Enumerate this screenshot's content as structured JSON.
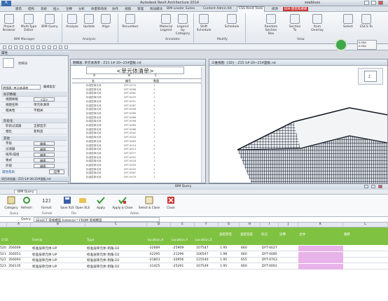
{
  "app": {
    "title": "Autodesk Revit Architecture 2014",
    "user": "seablues",
    "menu_label": "R"
  },
  "ribbon_tabs": [
    "建筑",
    "结构",
    "系统",
    "插入",
    "注释",
    "分析",
    "体量和场地",
    "协作",
    "视图",
    "管理",
    "附加模块",
    "BIM Leader Suites",
    "Content Admin Kit",
    "CSS Revit Tools",
    "修改",
    "BIM-建筑和楼梯"
  ],
  "ribbon": {
    "buttons": [
      "Project Browser",
      "Multi-Type Editor",
      "BIM Query",
      "Analyze",
      "Update",
      "Align",
      "Renumber",
      "Material Legend",
      "Legend by Category",
      "Shift Schedule",
      "Schedule",
      "Random Section Box",
      "Section To",
      "Item Overlay",
      "Select",
      "ESCS To"
    ],
    "panels": [
      "BIM Manager",
      "Analysis",
      "Annotate",
      "Modify",
      "View"
    ]
  },
  "left_pane": {
    "properties_title": "属性",
    "type_selector": "明细表: 单元体清单",
    "edit_type": "编辑类型",
    "sections": [
      {
        "name": "标识数据",
        "rows": [
          {
            "k": "视图样板",
            "v": "<无>",
            "btn": true
          },
          {
            "k": "视图名称",
            "v": "单元体清单"
          },
          {
            "k": "相关性",
            "v": "不相关"
          }
        ]
      },
      {
        "name": "阶段化",
        "rows": [
          {
            "k": "阶段过滤器",
            "v": "全部显示"
          },
          {
            "k": "相位",
            "v": "新构造"
          }
        ]
      },
      {
        "name": "其他",
        "rows": [
          {
            "k": "字段",
            "v": "编辑...",
            "btn": true
          },
          {
            "k": "过滤器",
            "v": "编辑...",
            "btn": true
          },
          {
            "k": "排序/成组",
            "v": "编辑...",
            "btn": true
          },
          {
            "k": "格式",
            "v": "编辑...",
            "btn": true
          },
          {
            "k": "外观",
            "v": "编辑...",
            "btn": true
          }
        ]
      }
    ],
    "help": "属性帮助",
    "apply": "应用",
    "browser_title": "项目浏览器 - Z15-1#-20-25#面板.rvt",
    "browser_item": "25",
    "browser_item2": "北立面图 (A14-25#)"
  },
  "schedule_window": {
    "title": "明细表: 单元体清单 - Z15-1#-20~25#面板.rvt",
    "sched_title": "<单元体清单>",
    "col_letters": [
      "A",
      "B",
      "C"
    ],
    "col_names": [
      "名",
      "编号",
      "数量"
    ],
    "rows": [
      [
        "标准层单元体",
        "DYT-0074",
        "1"
      ],
      [
        "标准层单元体",
        "DYT-0068",
        "1"
      ],
      [
        "标准层单元体",
        "DYT-0062",
        "1"
      ],
      [
        "标准层单元体",
        "DYT-0025",
        "1"
      ],
      [
        "标准层单元体",
        "DYT-0021",
        "1"
      ],
      [
        "标准层单元体",
        "DYT-0087",
        "1"
      ],
      [
        "标准层单元体",
        "DYT-0056",
        "1"
      ],
      [
        "标准层单元体",
        "DYT-0089",
        "1"
      ],
      [
        "标准层单元体",
        "DYT-0086",
        "1"
      ],
      [
        "标准层单元体",
        "DYT-0096",
        "1"
      ],
      [
        "标准层单元体",
        "DYT-0064",
        "1"
      ],
      [
        "标准层单元体",
        "DYT-0066",
        "1"
      ],
      [
        "标准层单元体",
        "DYT-0042",
        "1"
      ],
      [
        "标准层单元体",
        "DYT-0020",
        "1"
      ],
      [
        "标准层单元体",
        "DYT-0083",
        "1"
      ],
      [
        "标准层单元体",
        "DYT-0014",
        "1"
      ],
      [
        "标准层单元体",
        "DYT-0013",
        "1"
      ],
      [
        "标准层单元体",
        "DYT-0077",
        "1"
      ],
      [
        "标准层单元体",
        "DYT-0052",
        "1"
      ],
      [
        "标准层单元体",
        "DYT-0018",
        "1"
      ],
      [
        "标准层单元体",
        "DYT-0033",
        "1"
      ],
      [
        "标准层单元体",
        "DYT-0025",
        "1"
      ],
      [
        "标准层单元体",
        "DYT-0067",
        "1"
      ],
      [
        "标准层单元体",
        "DYT-0079",
        "1"
      ]
    ]
  },
  "view_window": {
    "title": "三维视图: {3D} - Z15-1#-20~25#面板.rvt",
    "nav_labels": [
      "上",
      "前"
    ]
  },
  "bim_query": {
    "title": "BIM Query",
    "tab": "BIM Query",
    "toolbar": [
      {
        "label": "Category",
        "group": "Query"
      },
      {
        "label": "Refresh",
        "group": "Query"
      },
      {
        "label": "Format",
        "group": "Format"
      },
      {
        "label": "Save XLS",
        "group": "File"
      },
      {
        "label": "Open XLS",
        "group": "File"
      },
      {
        "label": "Apply",
        "group": "Action"
      },
      {
        "label": "Apply & Close",
        "group": "Action"
      },
      {
        "label": "Select & Close",
        "group": "Action"
      },
      {
        "label": "Close",
        "group": "Action"
      }
    ],
    "query_label": "Query:",
    "query_text": "SELECT 常规模型 Instance * FROM 常规模型",
    "columns": [
      "A",
      "B",
      "C",
      "D",
      "E",
      "F",
      "G",
      "H",
      "I",
      "J",
      "K",
      "L"
    ],
    "green_headers": [
      {
        "col": "A",
        "text": "3 ID"
      },
      {
        "col": "B",
        "text": "Family"
      },
      {
        "col": "C",
        "text": "Type"
      },
      {
        "col": "D",
        "text": "location.X"
      },
      {
        "col": "E",
        "text": "Location.Y"
      },
      {
        "col": "F",
        "text": "Location.Z"
      },
      {
        "col": "G",
        "text": "尺寸标注 尺寸标注"
      },
      {
        "col": "H",
        "text": "尺寸标注 标识数据"
      },
      {
        "col": "I",
        "text": "标识数据 标识数据"
      },
      {
        "col": "J",
        "text": "标识数据 限制条件"
      },
      {
        "col": "K",
        "text": "限制条件"
      },
      {
        "col": "L",
        "text": "限制条件"
      }
    ],
    "green_sub": [
      "竖挺厚度",
      "竖挺宽度",
      "标记",
      "注释",
      "主体",
      "偏移"
    ],
    "rows": [
      {
        "n": "520",
        "id": "356009",
        "family": "标准层单元体-UP",
        "type": "标准层单元体-到角-D2",
        "x": "-32689",
        "y": "-25909",
        "z": "107547",
        "g": "1.95",
        "h": "660",
        "i": "DYT-0027"
      },
      {
        "n": "521",
        "id": "356051",
        "family": "标准层单元体-UP",
        "type": "标准层单元体-到角-D2",
        "x": "-32295",
        "y": "-21296",
        "z": "106547",
        "g": "1.98",
        "h": "660",
        "i": "DYT-0085"
      },
      {
        "n": "522",
        "id": "356093",
        "family": "标准层单元体-UP",
        "type": "标准层单元体-到角-D2",
        "x": "-31803",
        "y": "-20956",
        "z": "125540",
        "g": "1.95",
        "h": "655",
        "i": "DYT-0763"
      },
      {
        "n": "523",
        "id": "356135",
        "family": "标准层单元体-UP",
        "type": "标准层单元体-到角-D2",
        "x": "-31425",
        "y": "-25291",
        "z": "107549",
        "g": "1.95",
        "h": "660",
        "i": "DYT-0061"
      }
    ]
  }
}
